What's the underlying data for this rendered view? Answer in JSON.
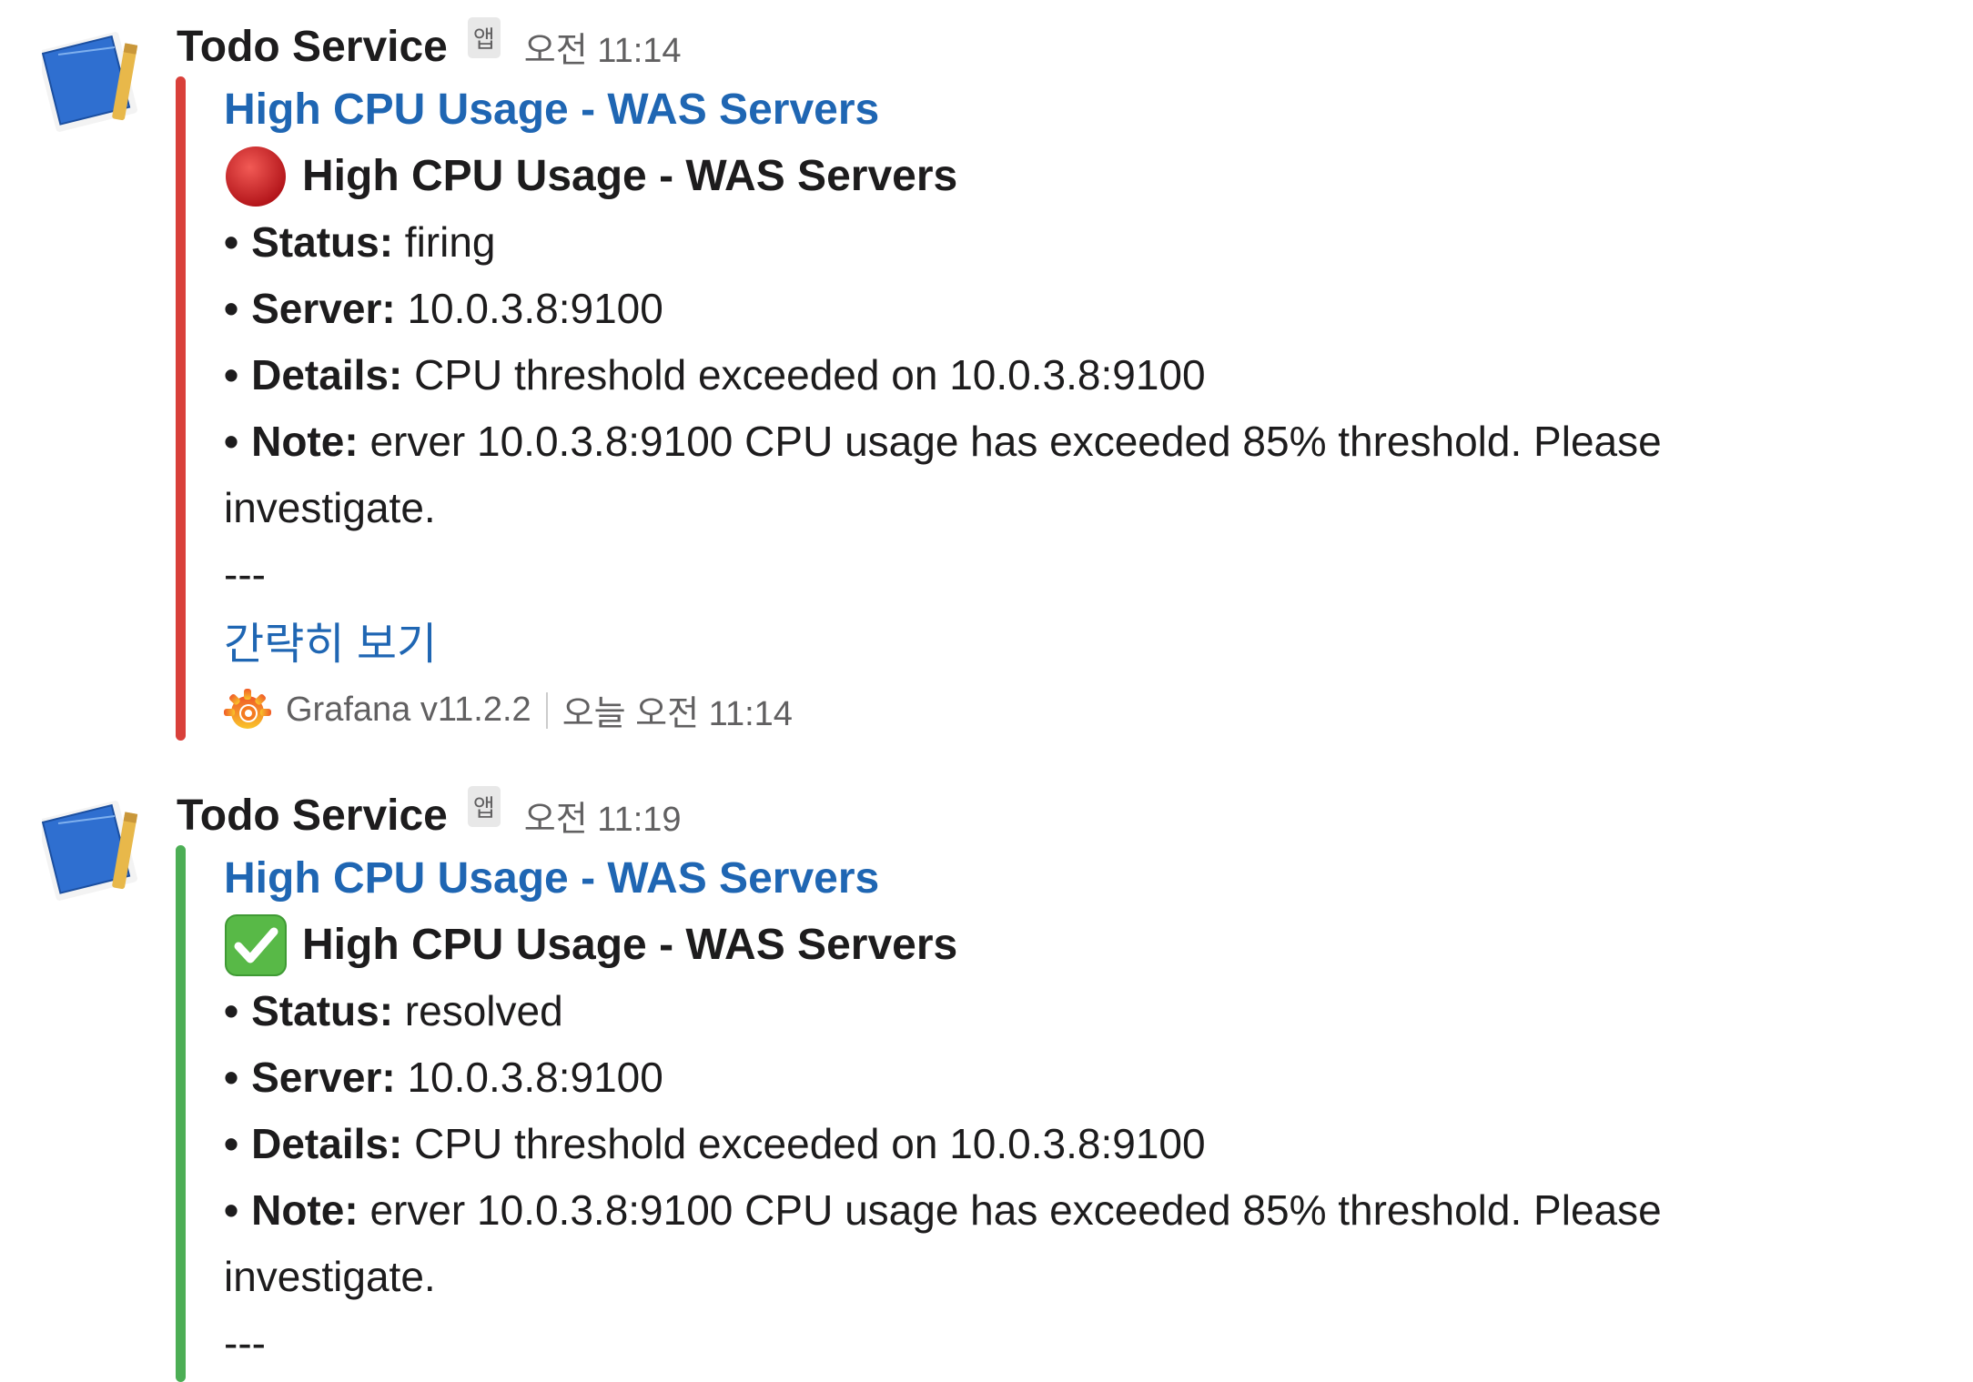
{
  "messages": [
    {
      "sender": "Todo Service",
      "app_badge": "앱",
      "time": "오전 11:14",
      "status_color": "#d9403a",
      "attachment": {
        "title_link": "High CPU Usage - WAS Servers",
        "status_emoji": "red-circle",
        "heading": "High CPU Usage - WAS Servers",
        "fields": [
          {
            "bullet": "•",
            "label": "Status:",
            "value": "firing"
          },
          {
            "bullet": "•",
            "label": "Server:",
            "value": "10.0.3.8:9100"
          },
          {
            "bullet": "•",
            "label": "Details:",
            "value": "CPU threshold exceeded on 10.0.3.8:9100"
          },
          {
            "bullet": "•",
            "label": "Note:",
            "value": "erver 10.0.3.8:9100 CPU usage has exceeded 85% threshold. Please investigate."
          }
        ],
        "separator": "---",
        "collapse_label": "간략히 보기",
        "footer_source": "Grafana v11.2.2",
        "footer_time": "오늘 오전 11:14"
      }
    },
    {
      "sender": "Todo Service",
      "app_badge": "앱",
      "time": "오전 11:19",
      "status_color": "#4cae55",
      "attachment": {
        "title_link": "High CPU Usage - WAS Servers",
        "status_emoji": "green-check",
        "heading": "High CPU Usage - WAS Servers",
        "fields": [
          {
            "bullet": "•",
            "label": "Status:",
            "value": "resolved"
          },
          {
            "bullet": "•",
            "label": "Server:",
            "value": "10.0.3.8:9100"
          },
          {
            "bullet": "•",
            "label": "Details:",
            "value": "CPU threshold exceeded on 10.0.3.8:9100"
          },
          {
            "bullet": "•",
            "label": "Note:",
            "value": "erver 10.0.3.8:9100 CPU usage has exceeded 85% threshold. Please investigate."
          }
        ],
        "separator": "---"
      }
    }
  ]
}
